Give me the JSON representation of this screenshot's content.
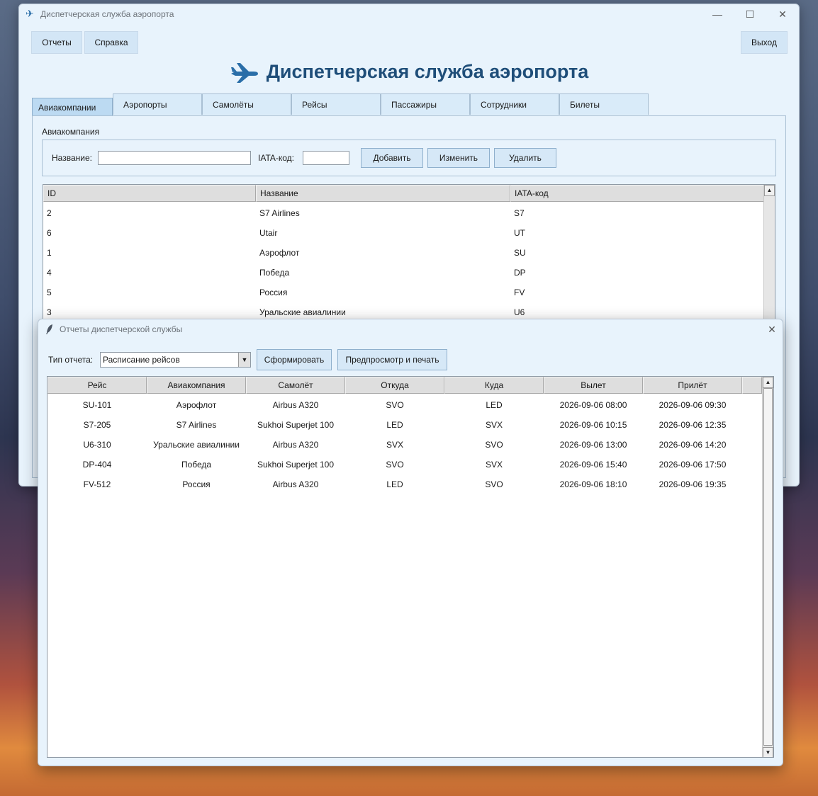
{
  "main_window": {
    "title": "Диспетчерская служба аэропорта",
    "menu": {
      "reports": "Отчеты",
      "help": "Справка",
      "exit": "Выход"
    },
    "heading": "Диспетчерская служба аэропорта",
    "tabs": [
      "Авиакомпании",
      "Аэропорты",
      "Самолёты",
      "Рейсы",
      "Пассажиры",
      "Сотрудники",
      "Билеты"
    ],
    "active_tab": "Авиакомпании",
    "form": {
      "group_label": "Авиакомпания",
      "name_label": "Название:",
      "name_value": "",
      "iata_label": "IATA-код:",
      "iata_value": "",
      "add_button": "Добавить",
      "edit_button": "Изменить",
      "delete_button": "Удалить"
    },
    "table": {
      "columns": [
        "ID",
        "Название",
        "IATA-код"
      ],
      "rows": [
        [
          "2",
          "S7 Airlines",
          "S7"
        ],
        [
          "6",
          "Utair",
          "UT"
        ],
        [
          "1",
          "Аэрофлот",
          "SU"
        ],
        [
          "4",
          "Победа",
          "DP"
        ],
        [
          "5",
          "Россия",
          "FV"
        ],
        [
          "3",
          "Уральские авиалинии",
          "U6"
        ]
      ]
    }
  },
  "reports_window": {
    "title": "Отчеты диспетчерской службы",
    "report_type_label": "Тип отчета:",
    "report_type_value": "Расписание рейсов",
    "generate_button": "Сформировать",
    "print_button": "Предпросмотр и печать",
    "table": {
      "columns": [
        "Рейс",
        "Авиакомпания",
        "Самолёт",
        "Откуда",
        "Куда",
        "Вылет",
        "Прилёт"
      ],
      "rows": [
        [
          "SU-101",
          "Аэрофлот",
          "Airbus A320",
          "SVO",
          "LED",
          "2026-09-06 08:00",
          "2026-09-06 09:30"
        ],
        [
          "S7-205",
          "S7 Airlines",
          "Sukhoi Superjet 100",
          "LED",
          "SVX",
          "2026-09-06 10:15",
          "2026-09-06 12:35"
        ],
        [
          "U6-310",
          "Уральские авиалинии",
          "Airbus A320",
          "SVX",
          "SVO",
          "2026-09-06 13:00",
          "2026-09-06 14:20"
        ],
        [
          "DP-404",
          "Победа",
          "Sukhoi Superjet 100",
          "SVO",
          "SVX",
          "2026-09-06 15:40",
          "2026-09-06 17:50"
        ],
        [
          "FV-512",
          "Россия",
          "Airbus A320",
          "LED",
          "SVO",
          "2026-09-06 18:10",
          "2026-09-06 19:35"
        ]
      ]
    }
  },
  "colors": {
    "accent": "#1f4e79",
    "window_bg": "#e8f3fc",
    "button_bg": "#d6e8f7"
  },
  "icons": {
    "app": "airplane-icon",
    "reports": "feather-icon"
  }
}
